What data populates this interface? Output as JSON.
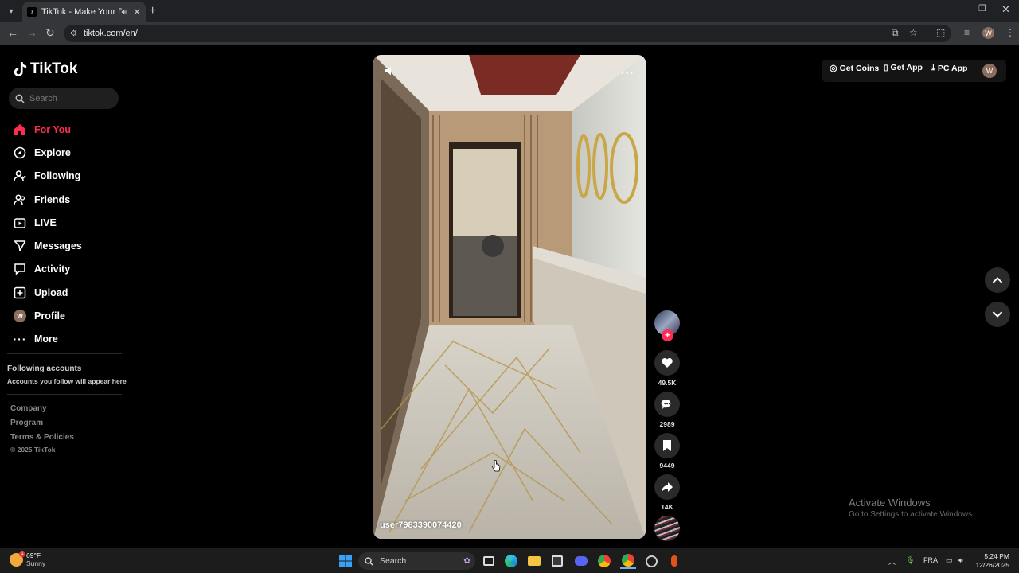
{
  "browser": {
    "tab_title": "TikTok - Make Your Day",
    "url": "tiktok.com/en/"
  },
  "sidebar": {
    "logo": "TikTok",
    "search_placeholder": "Search",
    "nav": [
      {
        "label": "For You",
        "icon": "home-icon",
        "active": true
      },
      {
        "label": "Explore",
        "icon": "compass-icon"
      },
      {
        "label": "Following",
        "icon": "following-icon"
      },
      {
        "label": "Friends",
        "icon": "friends-icon"
      },
      {
        "label": "LIVE",
        "icon": "live-icon"
      },
      {
        "label": "Messages",
        "icon": "messages-icon"
      },
      {
        "label": "Activity",
        "icon": "activity-icon"
      },
      {
        "label": "Upload",
        "icon": "upload-icon"
      },
      {
        "label": "Profile",
        "icon": "profile-avatar",
        "avatar_letter": "W"
      },
      {
        "label": "More",
        "icon": "more-icon"
      }
    ],
    "following_title": "Following accounts",
    "following_subtitle": "Accounts you follow will appear here",
    "footer": [
      "Company",
      "Program",
      "Terms & Policies"
    ],
    "copyright": "© 2025 TikTok"
  },
  "video": {
    "username": "user7983390074420"
  },
  "actions": {
    "likes": "49.5K",
    "comments": "2989",
    "saves": "9449",
    "shares": "14K"
  },
  "header": {
    "get_coins": "Get Coins",
    "get_app": "Get App",
    "pc_app": "PC App",
    "avatar_letter": "W"
  },
  "watermark": {
    "line1": "Activate Windows",
    "line2": "Go to Settings to activate Windows."
  },
  "taskbar": {
    "temp": "69°F",
    "condition": "Sunny",
    "search": "Search",
    "lang": "FRA",
    "time": "5:24 PM",
    "date": "12/26/2025"
  },
  "colors": {
    "accent": "#fe2c55",
    "background": "#000000",
    "chrome": "#35363a"
  }
}
